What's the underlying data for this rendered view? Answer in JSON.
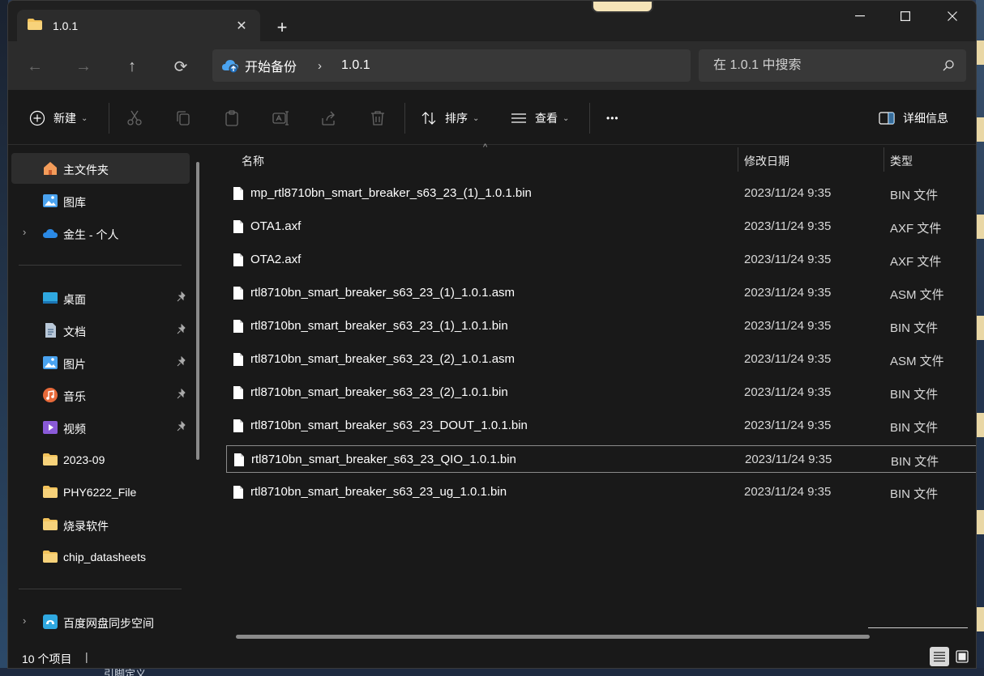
{
  "window": {
    "tab_title": "1.0.1",
    "tab_close": "✕",
    "new_tab": "+",
    "controls": {
      "minimize": "—",
      "maximize": "☐",
      "close": "✕"
    }
  },
  "nav": {
    "back": "←",
    "forward": "→",
    "up": "↑",
    "refresh": "⟳",
    "breadcrumb": [
      "开始备份",
      "1.0.1"
    ],
    "breadcrumb_sep": "›",
    "search_placeholder": "在 1.0.1 中搜索"
  },
  "toolbar": {
    "new_label": "新建",
    "sort_label": "排序",
    "view_label": "查看",
    "more_label": "•••",
    "details_label": "详细信息",
    "chevron": "⌄"
  },
  "sidebar": {
    "home": "主文件夹",
    "gallery": "图库",
    "cloud": "金生 - 个人",
    "pinned": [
      {
        "label": "桌面",
        "icon": "desktop-icon"
      },
      {
        "label": "文档",
        "icon": "documents-icon"
      },
      {
        "label": "图片",
        "icon": "pictures-icon"
      },
      {
        "label": "音乐",
        "icon": "music-icon"
      },
      {
        "label": "视频",
        "icon": "videos-icon"
      }
    ],
    "folders": [
      "2023-09",
      "PHY6222_File",
      "烧录软件",
      "chip_datasheets"
    ],
    "baidu": "百度网盘同步空间",
    "expander": "›"
  },
  "columns": {
    "name": "名称",
    "date": "修改日期",
    "type": "类型",
    "sort_indicator": "^"
  },
  "files": [
    {
      "name": "mp_rtl8710bn_smart_breaker_s63_23_(1)_1.0.1.bin",
      "date": "2023/11/24 9:35",
      "type": "BIN 文件"
    },
    {
      "name": "OTA1.axf",
      "date": "2023/11/24 9:35",
      "type": "AXF 文件"
    },
    {
      "name": "OTA2.axf",
      "date": "2023/11/24 9:35",
      "type": "AXF 文件"
    },
    {
      "name": "rtl8710bn_smart_breaker_s63_23_(1)_1.0.1.asm",
      "date": "2023/11/24 9:35",
      "type": "ASM 文件"
    },
    {
      "name": "rtl8710bn_smart_breaker_s63_23_(1)_1.0.1.bin",
      "date": "2023/11/24 9:35",
      "type": "BIN 文件"
    },
    {
      "name": "rtl8710bn_smart_breaker_s63_23_(2)_1.0.1.asm",
      "date": "2023/11/24 9:35",
      "type": "ASM 文件"
    },
    {
      "name": "rtl8710bn_smart_breaker_s63_23_(2)_1.0.1.bin",
      "date": "2023/11/24 9:35",
      "type": "BIN 文件"
    },
    {
      "name": "rtl8710bn_smart_breaker_s63_23_DOUT_1.0.1.bin",
      "date": "2023/11/24 9:35",
      "type": "BIN 文件"
    },
    {
      "name": "rtl8710bn_smart_breaker_s63_23_QIO_1.0.1.bin",
      "date": "2023/11/24 9:35",
      "type": "BIN 文件"
    },
    {
      "name": "rtl8710bn_smart_breaker_s63_23_ug_1.0.1.bin",
      "date": "2023/11/24 9:35",
      "type": "BIN 文件"
    }
  ],
  "status": {
    "count": "10 个项目",
    "caret": "|"
  },
  "desktop_peek": {
    "bottom_text": "引脚定义"
  },
  "colors": {
    "window_bg": "#191919",
    "titlebar_bg": "#202020",
    "tab_bg": "#2c2c2c",
    "folder_yellow": "#f2c25b",
    "accent_blue": "#4aa3f0"
  }
}
